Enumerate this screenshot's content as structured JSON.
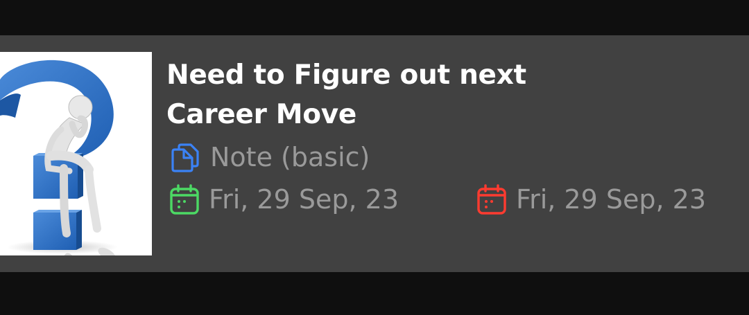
{
  "note": {
    "title_line1": "Need to Figure out next",
    "title_line2": "Career Move",
    "type_label": "Note (basic)",
    "created_date": "Fri, 29 Sep, 23",
    "due_date": "Fri, 29 Sep, 23"
  },
  "icons": {
    "type": "note-pages-icon",
    "created": "calendar-icon",
    "due": "calendar-icon"
  },
  "colors": {
    "card_bg": "#414141",
    "page_bg": "#0f0f0f",
    "title": "#ffffff",
    "meta_text": "#9a9a9a",
    "type_icon": "#3b82f6",
    "created_icon": "#4cd964",
    "due_icon": "#ff3b30"
  }
}
